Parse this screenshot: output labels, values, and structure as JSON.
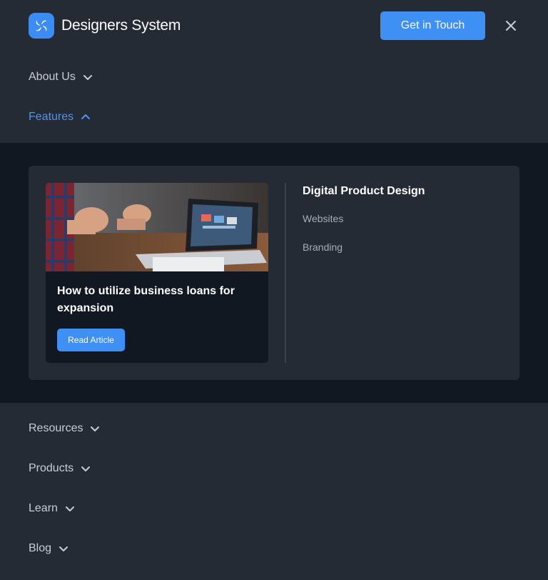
{
  "header": {
    "brand": "Designers System",
    "cta_label": "Get in Touch",
    "logo_icon": "swirl-logo-icon",
    "close_icon": "close-icon"
  },
  "nav": {
    "about": "About Us",
    "features": "Features",
    "resources": "Resources",
    "products": "Products",
    "learn": "Learn",
    "blog": "Blog"
  },
  "features_menu": {
    "card": {
      "title": "How to utilize business loans for expansion",
      "button_label": "Read Article"
    },
    "section_title": "Digital Product Design",
    "links": [
      "Websites",
      "Branding"
    ]
  },
  "colors": {
    "accent": "#3f90f5",
    "background": "#252b34",
    "dropdown_background": "#121821",
    "active_nav": "#4a96f5"
  }
}
